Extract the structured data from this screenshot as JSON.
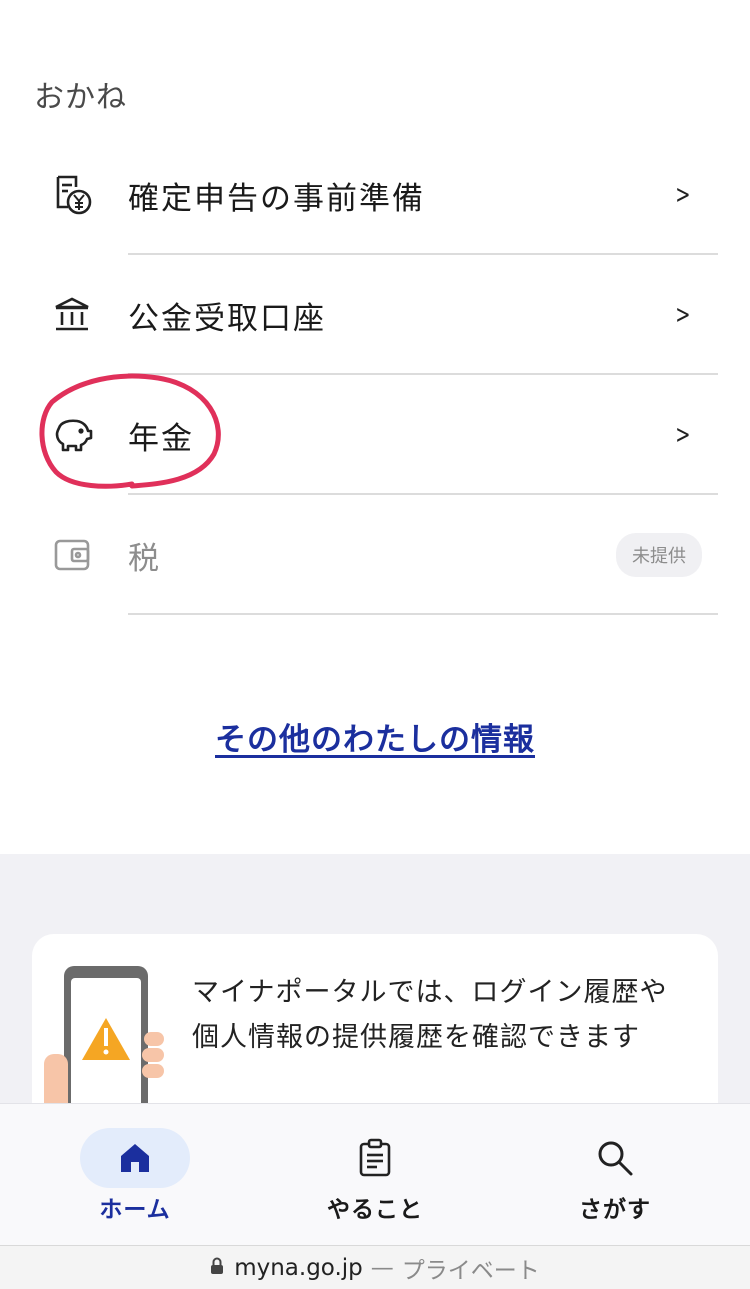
{
  "section": {
    "title": "おかね"
  },
  "menu": {
    "items": [
      {
        "label": "確定申告の事前準備",
        "icon": "tax-return-yen-icon",
        "enabled": true
      },
      {
        "label": "公金受取口座",
        "icon": "bank-icon",
        "enabled": true
      },
      {
        "label": "年金",
        "icon": "piggy-bank-icon",
        "enabled": true
      },
      {
        "label": "税",
        "icon": "wallet-icon",
        "enabled": false,
        "badge": "未提供"
      }
    ]
  },
  "more_link": {
    "label": "その他のわたしの情報"
  },
  "info_card": {
    "text": "マイナポータルでは、ログイン履歴や個人情報の提供履歴を確認できます"
  },
  "tabbar": {
    "tabs": [
      {
        "label": "ホーム",
        "icon": "home-icon",
        "active": true
      },
      {
        "label": "やること",
        "icon": "clipboard-icon",
        "active": false
      },
      {
        "label": "さがす",
        "icon": "search-icon",
        "active": false
      }
    ]
  },
  "url_bar": {
    "domain": "myna.go.jp",
    "separator": "—",
    "mode": "プライベート"
  },
  "colors": {
    "accent": "#1b2f9e",
    "annotation": "#e0305a",
    "tab_active_bg": "#e3ecfb",
    "gray_bg": "#f1f1f5"
  }
}
